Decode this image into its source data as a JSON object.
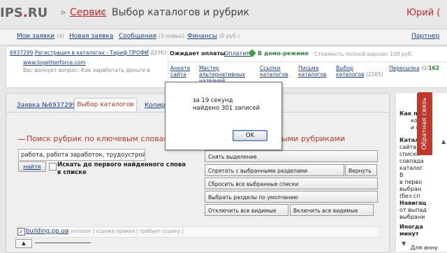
{
  "header": {
    "logo_main": "IPS",
    "logo_dot": ".",
    "logo_tld": "RU",
    "sep": "»",
    "section": "Сервис",
    "arrow": "»",
    "title": "Выбор каталогов и рубрик",
    "user": "Юрий ("
  },
  "nav": {
    "my_orders": "Мои заявки",
    "my_orders_count": "(4)",
    "new_order": "Новая заявка",
    "messages": "Сообщения",
    "messages_count": "(3 новых)",
    "finance": "Финансы",
    "finance_count": "(0 руб.)",
    "partners": "Партнер"
  },
  "info": {
    "order_number": "6937299",
    "order_text": "Регистрация в каталогах - Тариф ПРОФИ",
    "order_demo": "ДЕМО",
    "site": "www.togetherforce.com",
    "hint": "Вас волнует вопрос: Как заработать деньги в",
    "awaiting": "Ожидает оплаты",
    "pay": "Оплатить",
    "demo_mode": "В демо-режиме",
    "cost": "Стоимость полной версии: 100 руб.",
    "sub": {
      "anketa_1": "Анкета",
      "anketa_2": "сайта",
      "master_1": "Мастер",
      "master_2": "альтернативных",
      "master_3": "названий",
      "links_1": "Ссылки",
      "links_2": "каталогов",
      "letters_1": "Письма",
      "letters_2": "каталогов",
      "choice_1": "Выбор",
      "choice_2": "каталогов",
      "choice_count": "(2265)",
      "resend": "Пересылка",
      "resend_count": "(0/",
      "resend_162": "162"
    }
  },
  "tabs": {
    "order": "Заявка №6937299",
    "catalogs": "Выбор каталогов",
    "copy": "Копиров"
  },
  "search": {
    "heading": "Поиск рубрик по ключевым словам",
    "input_value": "работа, работа заработок, трудоустройство,",
    "find": "найти",
    "first_word": "Искать до первого найденного слова в списке"
  },
  "rubrics": {
    "heading_tail": "ными рубриками",
    "clear": "Снять выделение",
    "hide_selected": "Спрятать с выбранными разделами",
    "return": "Вернуть",
    "reset_selected": "Сбросить все выбранные списки",
    "choose_default": "Выбрать разделы по умолчанию",
    "disable_visible": "Отключить все видимые",
    "enable_visible": "Включить все видимые"
  },
  "list": {
    "check": "✓",
    "name": "building.pp.ua",
    "meta": "| каталог | ссылка прямая | требует ссылку |",
    "expand": "▲"
  },
  "right": {
    "how": "Как пол",
    "how_1": "которы",
    "how_2": "и нажм",
    "cat_head": "Катало",
    "cat_1": "сайта",
    "cat_2": "списке",
    "cat_3": "совпада",
    "cat_4": "каталог",
    "cat_5": "В",
    "cat_6": "в перво",
    "cat_7": "выбран",
    "cat_8": "(без сп",
    "nav_head": "Навигац",
    "nav_1": "от выпад",
    "nav_2": "выбрани",
    "sometimes_1": "Иногда",
    "sometimes_2": "минут",
    "for_annul": "Для анну",
    "feedback": "Обратная связь",
    "up": "▲",
    "down": "▼"
  },
  "dialog": {
    "line1": "за 19 секунд",
    "line2": "найдено 301 записей",
    "ok": "OK"
  }
}
